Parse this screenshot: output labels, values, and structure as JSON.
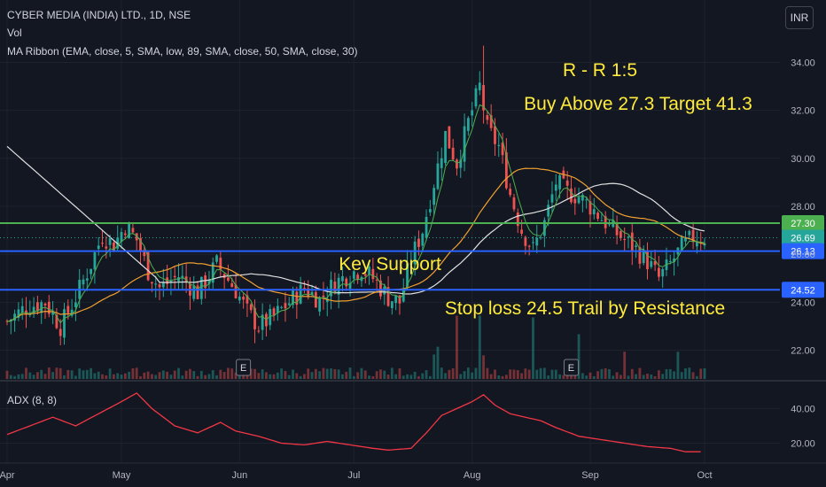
{
  "header": {
    "symbol_line": "CYBER MEDIA (INDIA) LTD., 1D, NSE",
    "vol_label": "Vol",
    "ma_ribbon_label": "MA Ribbon (EMA, close, 5, SMA, low, 89, SMA, close, 50, SMA, close, 30)"
  },
  "currency_button": "INR",
  "adx_label": "ADX (8, 8)",
  "annotations": {
    "rr": "R - R 1:5",
    "buy": "Buy Above 27.3 Target 41.3",
    "support": "Key Support",
    "stoploss": "Stop loss 24.5 Trail by Resistance"
  },
  "earnings_marker": "E",
  "colors": {
    "background": "#131722",
    "up": "#26a69a",
    "down": "#ef5350",
    "green_line": "#4caf50",
    "blue_line": "#2962ff",
    "annotation_text": "#ffeb3b",
    "adx_line": "#f23645",
    "ma_white": "#e0e0e0",
    "ma_orange": "#f0a030",
    "ma_green": "#4caf50"
  },
  "chart_data": {
    "type": "candlestick",
    "x_ticks": [
      "Apr",
      "May",
      "Jun",
      "Jul",
      "Aug",
      "Sep",
      "Oct"
    ],
    "price_axis": {
      "ticks": [
        "22.00",
        "24.00",
        "26.00",
        "28.00",
        "30.00",
        "32.00",
        "34.00"
      ],
      "range": [
        20.8,
        35.2
      ]
    },
    "adx_axis": {
      "ticks": [
        "20.00",
        "40.00"
      ],
      "range": [
        10,
        52
      ]
    },
    "levels": [
      {
        "label": "27.30",
        "value": 27.3,
        "color": "#4caf50"
      },
      {
        "label": "26.69",
        "value": 26.69,
        "color": "#26a69a"
      },
      {
        "label": "26.13",
        "value": 26.13,
        "color": "#2962ff"
      },
      {
        "label": "24.52",
        "value": 24.52,
        "color": "#2962ff"
      }
    ],
    "earnings_days": [
      62,
      148
    ],
    "months": [
      {
        "label": "Apr",
        "day": 0
      },
      {
        "label": "May",
        "day": 30
      },
      {
        "label": "Jun",
        "day": 61
      },
      {
        "label": "Jul",
        "day": 91
      },
      {
        "label": "Aug",
        "day": 122
      },
      {
        "label": "Sep",
        "day": 153
      },
      {
        "label": "Oct",
        "day": 183
      }
    ],
    "price_anchors": [
      [
        0,
        23.2
      ],
      [
        5,
        23.8
      ],
      [
        10,
        24.0
      ],
      [
        14,
        23.0
      ],
      [
        18,
        24.2
      ],
      [
        22,
        25.6
      ],
      [
        25,
        26.8
      ],
      [
        28,
        26.4
      ],
      [
        31,
        27.2
      ],
      [
        34,
        26.6
      ],
      [
        37,
        25.3
      ],
      [
        40,
        24.6
      ],
      [
        45,
        25.1
      ],
      [
        50,
        24.4
      ],
      [
        55,
        25.6
      ],
      [
        60,
        24.5
      ],
      [
        63,
        23.6
      ],
      [
        66,
        23.0
      ],
      [
        70,
        23.4
      ],
      [
        74,
        24.0
      ],
      [
        78,
        24.6
      ],
      [
        82,
        24.1
      ],
      [
        86,
        24.8
      ],
      [
        90,
        25.2
      ],
      [
        93,
        25.4
      ],
      [
        96,
        25.0
      ],
      [
        100,
        24.2
      ],
      [
        103,
        24.0
      ],
      [
        106,
        25.8
      ],
      [
        109,
        27.0
      ],
      [
        112,
        29.0
      ],
      [
        115,
        31.0
      ],
      [
        118,
        29.8
      ],
      [
        121,
        31.5
      ],
      [
        124,
        33.0
      ],
      [
        126,
        31.2
      ],
      [
        129,
        30.5
      ],
      [
        132,
        28.5
      ],
      [
        135,
        27.0
      ],
      [
        138,
        26.2
      ],
      [
        141,
        27.3
      ],
      [
        144,
        29.0
      ],
      [
        147,
        28.6
      ],
      [
        150,
        28.4
      ],
      [
        153,
        28.0
      ],
      [
        156,
        27.5
      ],
      [
        159,
        27.0
      ],
      [
        162,
        26.6
      ],
      [
        165,
        26.2
      ],
      [
        168,
        25.7
      ],
      [
        171,
        25.0
      ],
      [
        174,
        25.6
      ],
      [
        177,
        26.3
      ],
      [
        180,
        26.7
      ]
    ],
    "adx_anchors": [
      [
        0,
        25
      ],
      [
        6,
        30
      ],
      [
        12,
        35
      ],
      [
        18,
        30
      ],
      [
        24,
        37
      ],
      [
        30,
        44
      ],
      [
        34,
        49
      ],
      [
        38,
        40
      ],
      [
        44,
        30
      ],
      [
        50,
        26
      ],
      [
        56,
        32
      ],
      [
        60,
        27
      ],
      [
        66,
        24
      ],
      [
        72,
        20
      ],
      [
        78,
        19
      ],
      [
        84,
        21
      ],
      [
        90,
        19
      ],
      [
        96,
        17
      ],
      [
        100,
        16
      ],
      [
        106,
        17
      ],
      [
        110,
        26
      ],
      [
        114,
        36
      ],
      [
        118,
        40
      ],
      [
        122,
        44
      ],
      [
        125,
        48
      ],
      [
        128,
        42
      ],
      [
        132,
        37
      ],
      [
        136,
        35
      ],
      [
        140,
        33
      ],
      [
        144,
        29
      ],
      [
        150,
        24
      ],
      [
        156,
        22
      ],
      [
        162,
        20
      ],
      [
        168,
        18
      ],
      [
        174,
        17
      ],
      [
        178,
        15
      ],
      [
        182,
        15
      ]
    ]
  }
}
